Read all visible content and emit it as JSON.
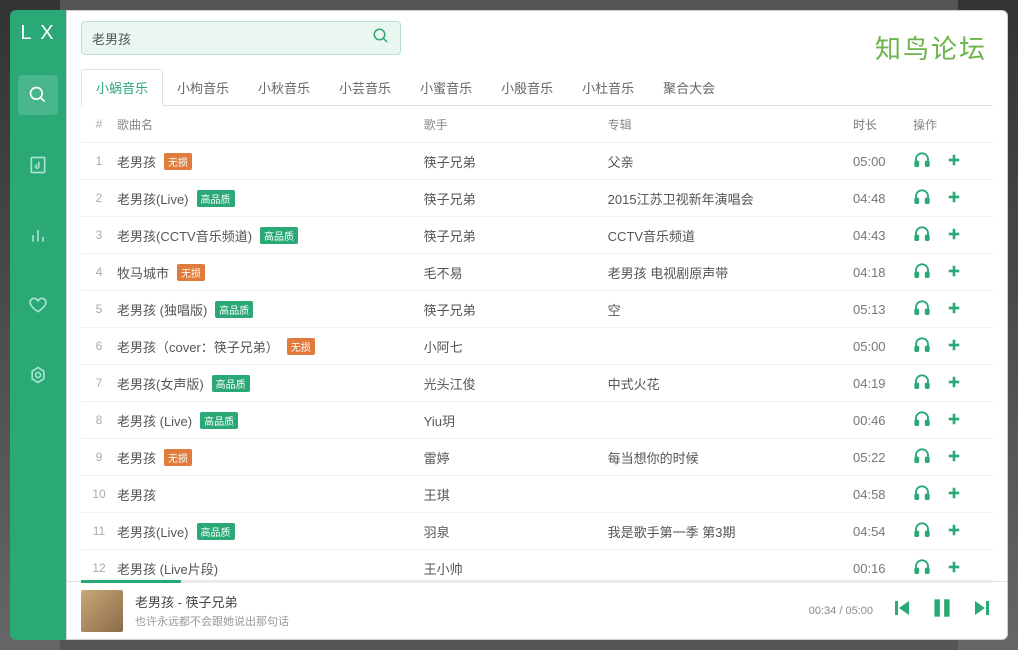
{
  "logo": "L X",
  "watermark": "知鸟论坛",
  "search": {
    "value": "老男孩"
  },
  "tabs": [
    "小蜗音乐",
    "小枸音乐",
    "小秋音乐",
    "小芸音乐",
    "小蜜音乐",
    "小殷音乐",
    "小杜音乐",
    "聚合大会"
  ],
  "activeTab": 0,
  "columns": {
    "idx": "#",
    "name": "歌曲名",
    "artist": "歌手",
    "album": "专辑",
    "dur": "时长",
    "ops": "操作"
  },
  "badgeLabels": {
    "lossless": "无损",
    "hq": "高品质"
  },
  "rows": [
    {
      "idx": 1,
      "name": "老男孩",
      "badge": "lossless",
      "artist": "筷子兄弟",
      "album": "父亲",
      "dur": "05:00"
    },
    {
      "idx": 2,
      "name": "老男孩(Live)",
      "badge": "hq",
      "artist": "筷子兄弟",
      "album": "2015江苏卫视新年演唱会",
      "dur": "04:48"
    },
    {
      "idx": 3,
      "name": "老男孩(CCTV音乐频道)",
      "badge": "hq",
      "artist": "筷子兄弟",
      "album": "CCTV音乐频道",
      "dur": "04:43"
    },
    {
      "idx": 4,
      "name": "牧马城市",
      "badge": "lossless",
      "artist": "毛不易",
      "album": "老男孩 电视剧原声带",
      "dur": "04:18"
    },
    {
      "idx": 5,
      "name": "老男孩 (独唱版)",
      "badge": "hq",
      "artist": "筷子兄弟",
      "album": "空",
      "dur": "05:13"
    },
    {
      "idx": 6,
      "name": "老男孩（cover：筷子兄弟）",
      "badge": "lossless",
      "artist": "小阿七",
      "album": "",
      "dur": "05:00"
    },
    {
      "idx": 7,
      "name": "老男孩(女声版)",
      "badge": "hq",
      "artist": "光头江俊",
      "album": "中式火花",
      "dur": "04:19"
    },
    {
      "idx": 8,
      "name": "老男孩 (Live)",
      "badge": "hq",
      "artist": "Yiu玥",
      "album": "",
      "dur": "00:46"
    },
    {
      "idx": 9,
      "name": "老男孩",
      "badge": "lossless",
      "artist": "雷婷",
      "album": "每当想你的时候",
      "dur": "05:22"
    },
    {
      "idx": 10,
      "name": "老男孩",
      "badge": "",
      "artist": "王琪",
      "album": "",
      "dur": "04:58"
    },
    {
      "idx": 11,
      "name": "老男孩(Live)",
      "badge": "hq",
      "artist": "羽泉",
      "album": "我是歌手第一季 第3期",
      "dur": "04:54"
    },
    {
      "idx": 12,
      "name": "老男孩 (Live片段)",
      "badge": "",
      "artist": "王小帅",
      "album": "",
      "dur": "00:16"
    }
  ],
  "player": {
    "title": "老男孩 - 筷子兄弟",
    "lyric": "也许永远都不会跟她说出那句话",
    "elapsed": "00:34",
    "total": "05:00"
  }
}
